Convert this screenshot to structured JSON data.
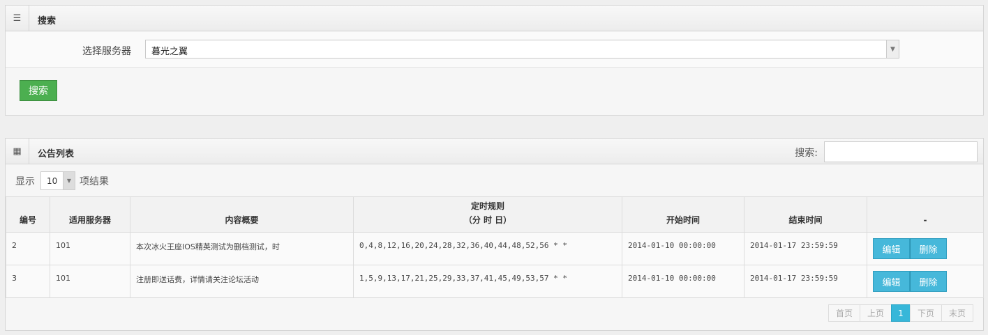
{
  "search_panel": {
    "title": "搜索",
    "icon": "list-icon",
    "server_label": "选择服务器",
    "server_value": "暮光之翼",
    "search_button": "搜索"
  },
  "list_panel": {
    "title": "公告列表",
    "icon": "columns-icon",
    "search_label": "搜索:",
    "search_value": "",
    "show_label": "显示",
    "page_size": "10",
    "results_label": "项结果",
    "columns": [
      "编号",
      "适用服务器",
      "内容概要",
      "定时规则",
      "（分 时 日）",
      "开始时间",
      "结束时间",
      "-"
    ],
    "rows": [
      {
        "id": "2",
        "server": "101",
        "summary": "本次冰火王座IOS精英测试为删档测试，时",
        "schedule": "0,4,8,12,16,20,24,28,32,36,40,44,48,52,56 * *",
        "start": "2014-01-10 00:00:00",
        "end": "2014-01-17 23:59:59",
        "edit": "编辑",
        "delete": "删除"
      },
      {
        "id": "3",
        "server": "101",
        "summary": "注册即送话费，详情请关注论坛活动",
        "schedule": "1,5,9,13,17,21,25,29,33,37,41,45,49,53,57 * *",
        "start": "2014-01-10 00:00:00",
        "end": "2014-01-17 23:59:59",
        "edit": "编辑",
        "delete": "删除"
      }
    ],
    "pagination": {
      "first": "首页",
      "prev": "上页",
      "current": "1",
      "next": "下页",
      "last": "末页"
    }
  },
  "colors": {
    "green_button": "#4caf50",
    "blue_button": "#46b8da",
    "active_page": "#37b7d9"
  }
}
